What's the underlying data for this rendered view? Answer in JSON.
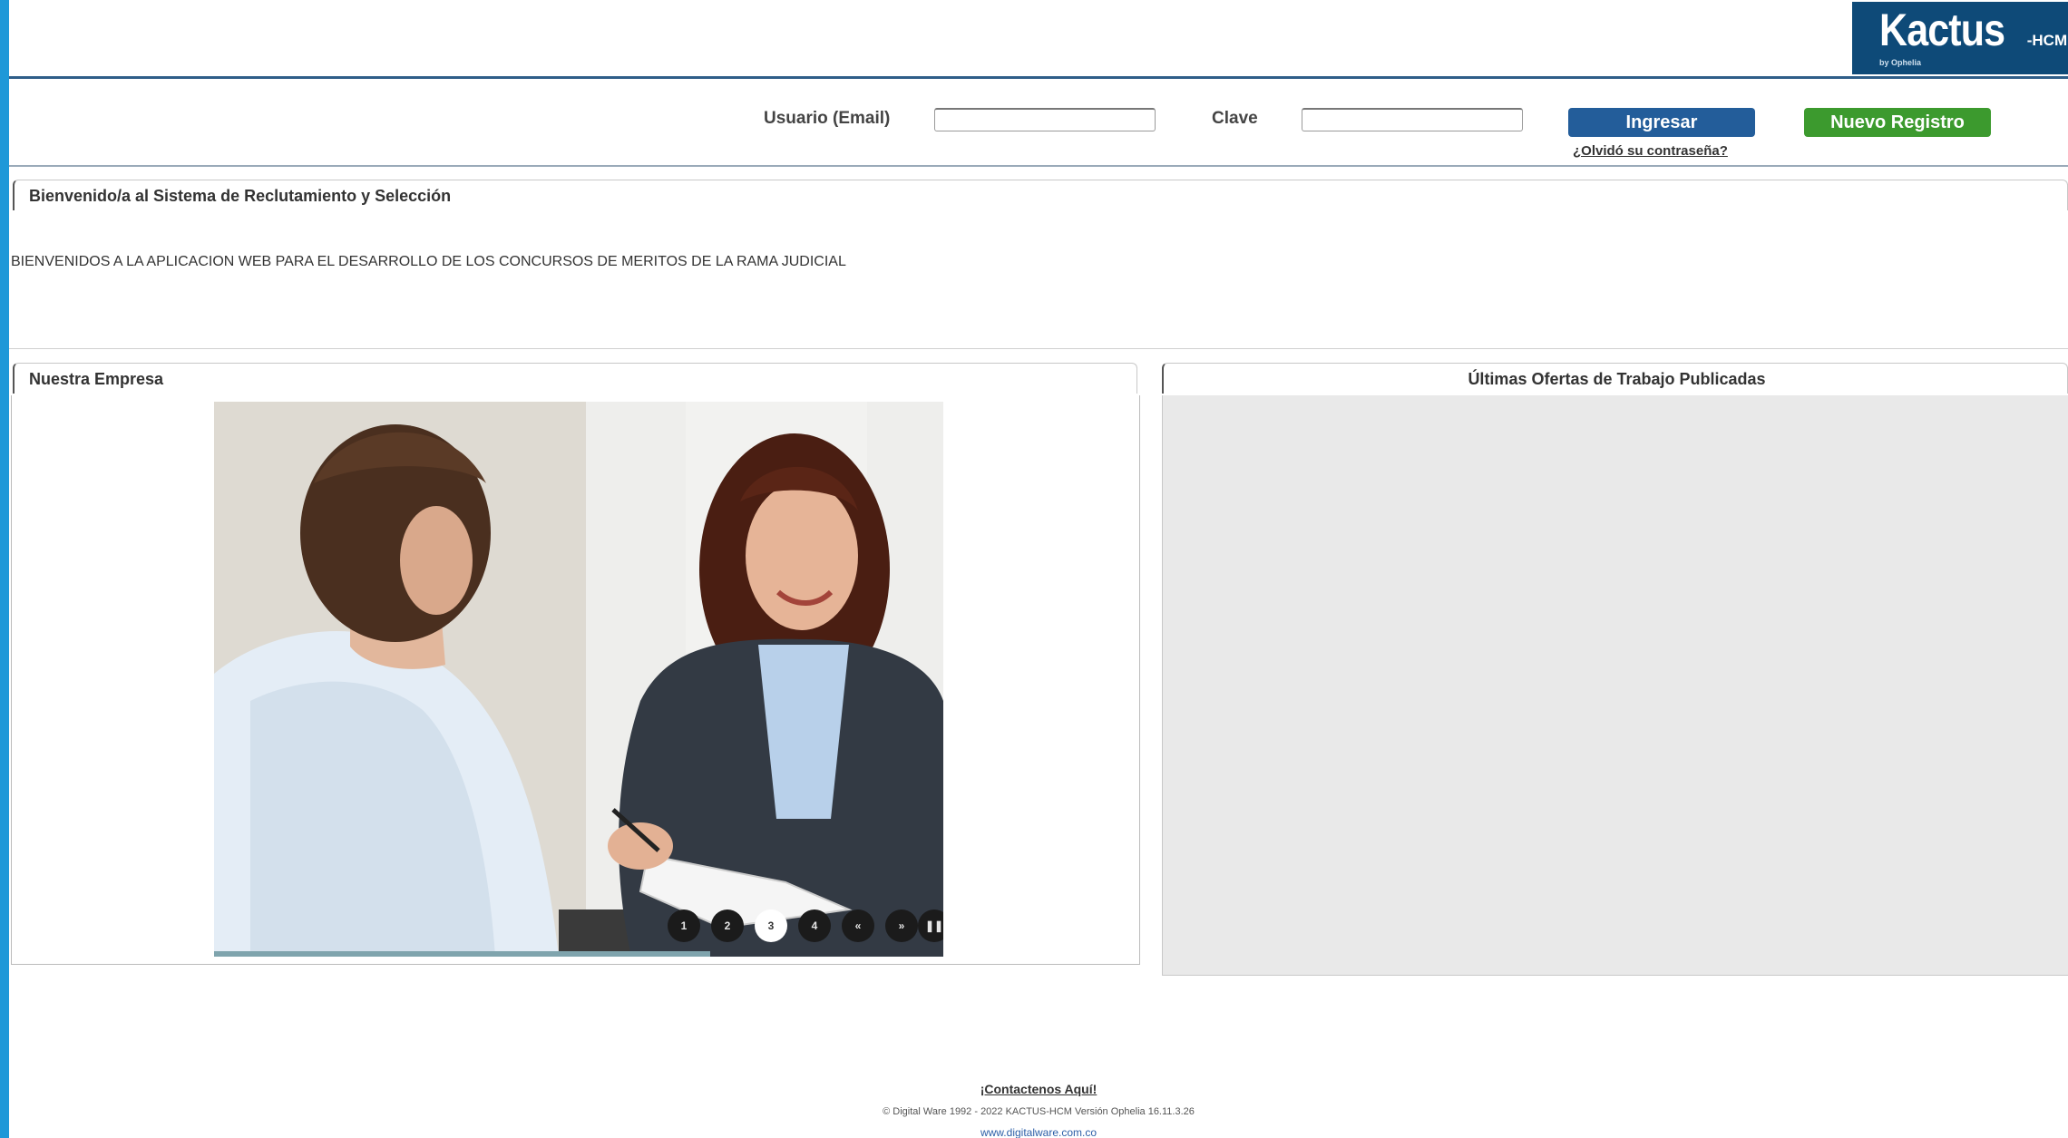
{
  "header": {
    "logo_text": "Kactus",
    "logo_suffix": "-HCM",
    "logo_sub": "by Ophelia"
  },
  "login": {
    "user_label": "Usuario (Email)",
    "user_value": "",
    "password_label": "Clave",
    "password_value": "",
    "login_button": "Ingresar",
    "register_button": "Nuevo Registro",
    "forgot_link": "¿Olvidó su contraseña?"
  },
  "welcome": {
    "title": "Bienvenido/a al Sistema de Reclutamiento y Selección",
    "text": "BIENVENIDOS A LA APLICACION WEB PARA EL DESARROLLO DE LOS CONCURSOS DE MERITOS DE LA RAMA JUDICIAL"
  },
  "company": {
    "title": "Nuestra Empresa",
    "slides": [
      "1",
      "2",
      "3",
      "4"
    ],
    "active_slide": "3",
    "prev_symbol": "«",
    "next_symbol": "»",
    "pause_symbol": "❚❚",
    "slide_progress": 0.68
  },
  "offers": {
    "title": "Últimas Ofertas de Trabajo Publicadas"
  },
  "footer": {
    "contact_link": "¡Contactenos Aquí!",
    "copyright": "© Digital Ware 1992 - 2022 KACTUS-HCM Versión Ophelia 16.11.3.26",
    "url": "www.digitalware.com.co"
  },
  "colors": {
    "frame_blue": "#1e98d8",
    "login_button": "#235d9a",
    "register_button": "#3c9a2e",
    "logo_bg": "#0e4a78"
  }
}
